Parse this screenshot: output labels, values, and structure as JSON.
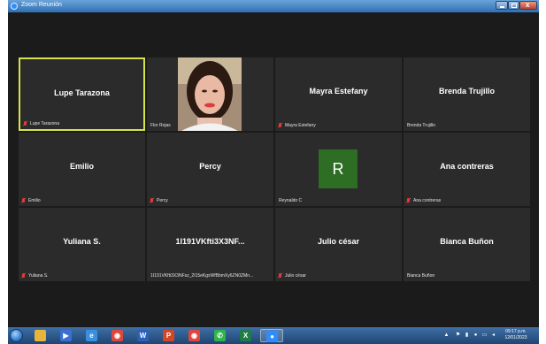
{
  "window": {
    "title": "Zoom Reunión"
  },
  "participants": [
    {
      "name": "Lupe Tarazona",
      "label": "Lupe Tarazona",
      "muted": true,
      "active": true
    },
    {
      "name": "",
      "label": "Flor Rojas",
      "muted": false,
      "video": true
    },
    {
      "name": "Mayra Estefany",
      "label": "Mayra Estefany",
      "muted": true
    },
    {
      "name": "Brenda Trujillo",
      "label": "Brenda Trujillo",
      "muted": false
    },
    {
      "name": "Emilio",
      "label": "Emilio",
      "muted": true
    },
    {
      "name": "Percy",
      "label": "Percy",
      "muted": true
    },
    {
      "name": "",
      "label": "Reynaldo C",
      "muted": false,
      "avatar_letter": "R",
      "avatar_color": "#2e6e24"
    },
    {
      "name": "Ana contreras",
      "label": "Ana contreras",
      "muted": true
    },
    {
      "name": "Yuliana S.",
      "label": "Yuliana S.",
      "muted": true
    },
    {
      "name": "1I191VKfti3X3NF...",
      "label": "1I191VKfti3X3NFsz_2I15eKgxWfBbmXy6ZN0ZMn...",
      "muted": false
    },
    {
      "name": "Julio césar",
      "label": "Julio césar",
      "muted": true
    },
    {
      "name": "Bianca Buñon",
      "label": "Bianca Buñon",
      "muted": false
    }
  ],
  "taskbar": {
    "apps": [
      "windows-explorer",
      "media-player",
      "internet-explorer",
      "chrome",
      "word",
      "powerpoint",
      "chrome-2",
      "whatsapp",
      "excel",
      "zoom"
    ],
    "clock_time": "09:17 p.m.",
    "clock_date": "12/01/2023"
  },
  "colors": {
    "meeting_bg": "#1b1b1b",
    "tile_bg": "#2b2b2b",
    "active_border": "#d8e24a",
    "mic_muted": "#e23b3b"
  }
}
